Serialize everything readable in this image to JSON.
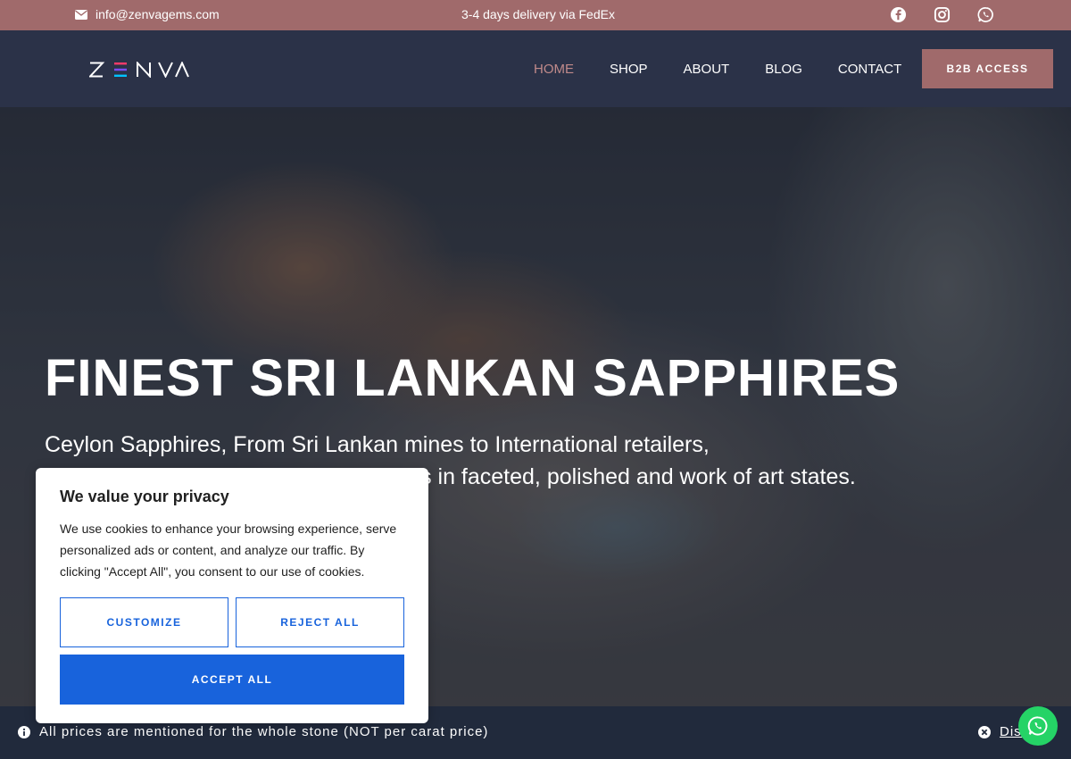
{
  "topbar": {
    "email": "info@zenvagems.com",
    "delivery": "3-4 days delivery via FedEx",
    "socials": [
      "facebook-icon",
      "instagram-icon",
      "whatsapp-icon"
    ],
    "color": "#a06a6b"
  },
  "nav": {
    "logo": "ZENVA",
    "items": [
      {
        "label": "HOME",
        "active": true
      },
      {
        "label": "SHOP"
      },
      {
        "label": "ABOUT"
      },
      {
        "label": "BLOG"
      },
      {
        "label": "CONTACT"
      }
    ],
    "cta": "B2B ACCESS"
  },
  "hero": {
    "title": "FINEST SRI LANKAN SAPPHIRES",
    "subtitle_line1": "Ceylon Sapphires, From Sri Lankan mines to International retailers,",
    "subtitle_line2": "we deliver the finest natural gemstones in faceted, polished and work of art states."
  },
  "cookie": {
    "title": "We value your privacy",
    "text": "We use cookies to enhance your browsing experience, serve personalized ads or content, and analyze our traffic. By clicking \"Accept All\", you consent to our use of cookies.",
    "customize": "CUSTOMIZE",
    "reject": "REJECT ALL",
    "accept": "ACCEPT ALL",
    "accent": "#1863dc"
  },
  "notice": {
    "message": "All prices are mentioned for the whole stone (NOT per carat price)",
    "dismiss": "Dismiss"
  }
}
